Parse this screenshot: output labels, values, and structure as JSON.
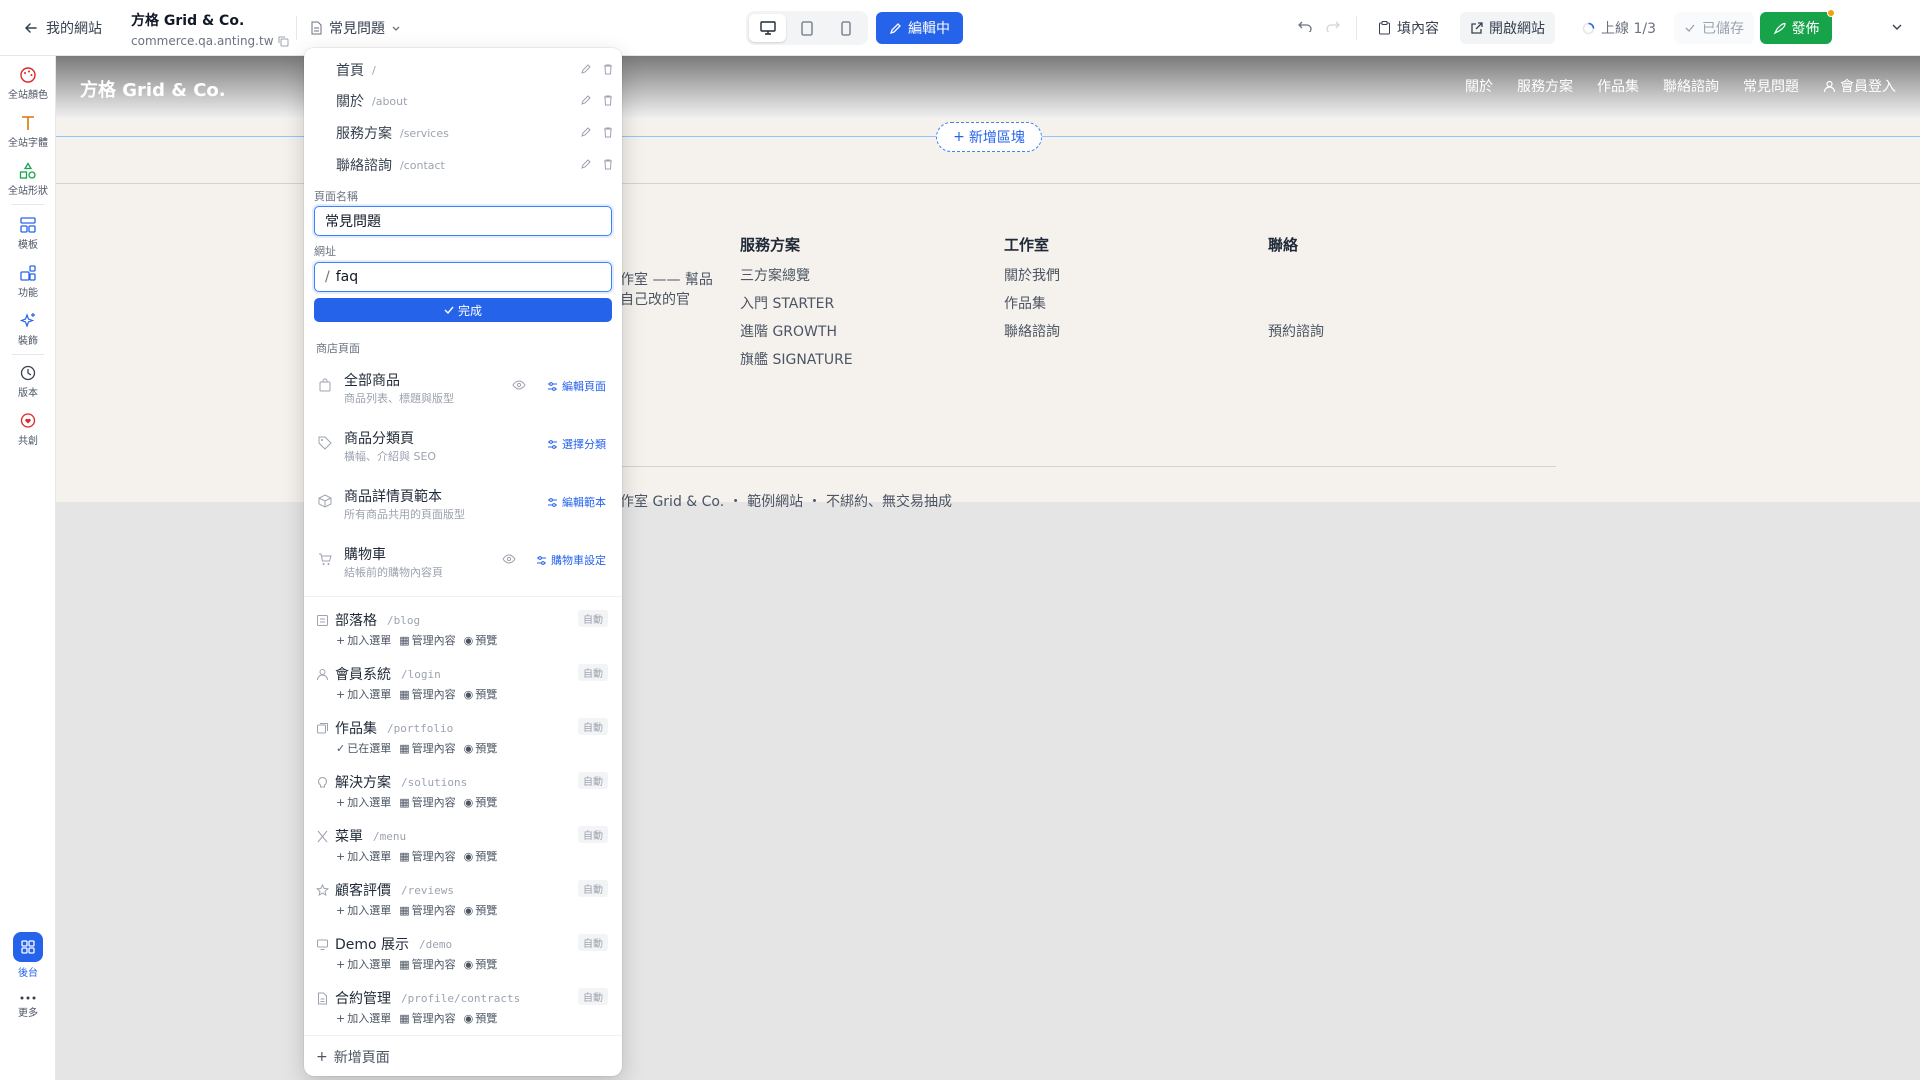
{
  "topbar": {
    "back_label": "我的網站",
    "site_name": "方格 Grid & Co.",
    "site_url": "commerce.qa.anting.tw",
    "current_page": "常見問題",
    "edit_label": "編輯中",
    "fill_content_label": "填內容",
    "open_site_label": "開啟網站",
    "upload_status": "上線 1/3",
    "saved_label": "已儲存",
    "publish_label": "發佈"
  },
  "rail": {
    "colors": "全站顏色",
    "fonts": "全站字體",
    "shapes": "全站形狀",
    "templates": "模板",
    "features": "功能",
    "decor": "裝飾",
    "versions": "版本",
    "cocreate": "共創",
    "admin": "後台",
    "more": "更多"
  },
  "site": {
    "logo": "方格 Grid & Co.",
    "nav": [
      "關於",
      "服務方案",
      "作品集",
      "聯絡諮詢",
      "常見問題",
      "會員登入"
    ],
    "add_block": "新增區塊",
    "intro_fragment_1": "作室 —— 幫品",
    "intro_fragment_2": "自己改的官",
    "footer_cols": [
      {
        "head": "服務方案",
        "links": [
          "三方案總覽",
          "入門 STARTER",
          "進階 GROWTH",
          "旗艦 SIGNATURE"
        ]
      },
      {
        "head": "工作室",
        "links": [
          "關於我們",
          "作品集",
          "聯絡諮詢"
        ]
      },
      {
        "head": "聯絡",
        "links": [
          "",
          "",
          "預約諮詢"
        ]
      }
    ],
    "copyright": "作室 Grid & Co. ・ 範例網站 ・ 不綁約、無交易抽成"
  },
  "popover": {
    "pages": [
      {
        "name": "首頁",
        "path": "/"
      },
      {
        "name": "關於",
        "path": "/about"
      },
      {
        "name": "服務方案",
        "path": "/services"
      },
      {
        "name": "聯絡諮詢",
        "path": "/contact"
      }
    ],
    "page_name_label": "頁面名稱",
    "page_name_value": "常見問題",
    "url_label": "網址",
    "url_prefix": "/",
    "url_value": "faq",
    "done_label": "完成",
    "shop_section_label": "商店頁面",
    "shop_pages": [
      {
        "title": "全部商品",
        "sub": "商品列表、標題與版型",
        "action": "編輯頁面"
      },
      {
        "title": "商品分類頁",
        "sub": "橫幅、介紹與 SEO",
        "action": "選擇分類"
      },
      {
        "title": "商品詳情頁範本",
        "sub": "所有商品共用的頁面版型",
        "action": "編輯範本"
      },
      {
        "title": "購物車",
        "sub": "結帳前的購物內容頁",
        "action": "購物車設定"
      }
    ],
    "modules": [
      {
        "name": "部落格",
        "path": "/blog",
        "icon": "blog-icon",
        "add": "加入選單",
        "added": false
      },
      {
        "name": "會員系統",
        "path": "/login",
        "icon": "user-icon",
        "add": "加入選單",
        "added": false
      },
      {
        "name": "作品集",
        "path": "/portfolio",
        "icon": "portfolio-icon",
        "add": "已在選單",
        "added": true
      },
      {
        "name": "解決方案",
        "path": "/solutions",
        "icon": "lightbulb-icon",
        "add": "加入選單",
        "added": false
      },
      {
        "name": "菜單",
        "path": "/menu",
        "icon": "utensils-icon",
        "add": "加入選單",
        "added": false
      },
      {
        "name": "顧客評價",
        "path": "/reviews",
        "icon": "star-icon",
        "add": "加入選單",
        "added": false
      },
      {
        "name": "Demo 展示",
        "path": "/demo",
        "icon": "monitor-icon",
        "add": "加入選單",
        "added": false
      },
      {
        "name": "合約管理",
        "path": "/profile/contracts",
        "icon": "document-icon",
        "add": "加入選單",
        "added": false
      }
    ],
    "manage_label": "管理內容",
    "preview_label": "預覽",
    "auto_badge": "自動",
    "new_page_label": "新增頁面"
  },
  "colors": {
    "primary": "#2563eb",
    "publish": "#16a34a",
    "canvas_bg": "#e5e5e5",
    "site_bg": "#f5f2ed"
  }
}
